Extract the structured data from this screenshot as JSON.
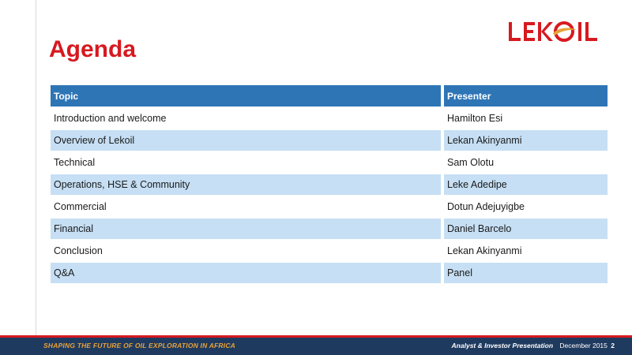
{
  "logo": {
    "text": "LEKOIL",
    "accent": "#d71920"
  },
  "title": "Agenda",
  "table": {
    "headers": [
      "Topic",
      "Presenter"
    ],
    "rows": [
      {
        "topic": "Introduction and welcome",
        "presenter": "Hamilton Esi"
      },
      {
        "topic": "Overview of Lekoil",
        "presenter": "Lekan Akinyanmi"
      },
      {
        "topic": "Technical",
        "presenter": "Sam Olotu"
      },
      {
        "topic": "Operations, HSE & Community",
        "presenter": "Leke Adedipe"
      },
      {
        "topic": "Commercial",
        "presenter": "Dotun Adejuyigbe"
      },
      {
        "topic": "Financial",
        "presenter": "Daniel Barcelo"
      },
      {
        "topic": "Conclusion",
        "presenter": "Lekan Akinyanmi"
      },
      {
        "topic": "Q&A",
        "presenter": "Panel"
      }
    ]
  },
  "footer": {
    "tagline": "SHAPING THE FUTURE OF OIL EXPLORATION IN AFRICA",
    "presentation": "Analyst & Investor Presentation",
    "date": "December 2015",
    "page": "2"
  },
  "colors": {
    "header_blue": "#2e75b6",
    "row_light_blue": "#c6dff4",
    "footer_navy": "#1f3a5f",
    "footer_gold": "#e8a23a",
    "title_red": "#d71920"
  }
}
